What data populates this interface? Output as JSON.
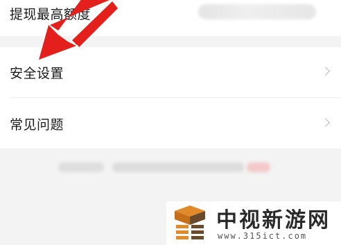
{
  "settings": {
    "top_row_label": "提现最高额度",
    "items": [
      {
        "label": "安全设置"
      },
      {
        "label": "常见问题"
      }
    ]
  },
  "annotation": {
    "arrow_color": "#e3201b"
  },
  "watermark": {
    "title": "中视新游网",
    "url": "www.315ict.com",
    "colors": [
      "#e08a2a",
      "#6b4a2b"
    ]
  }
}
